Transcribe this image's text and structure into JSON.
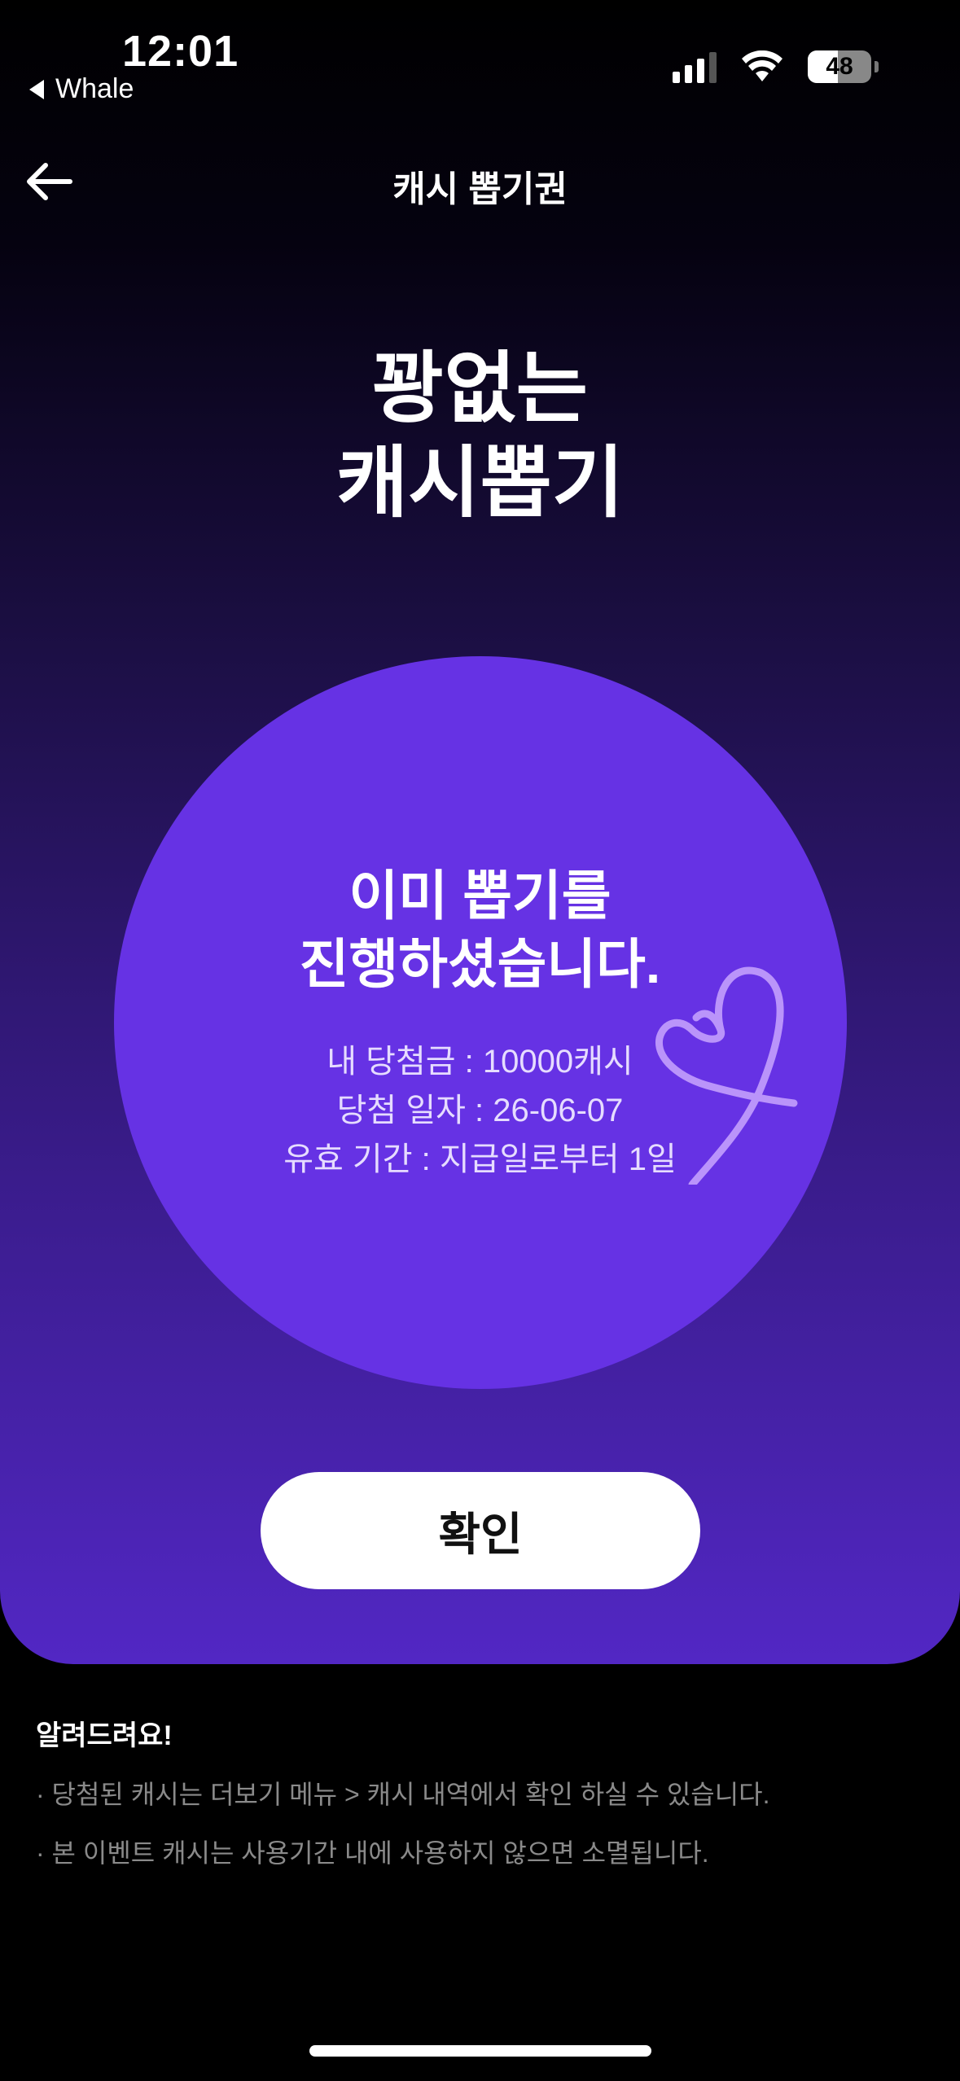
{
  "status_bar": {
    "time": "12:01",
    "back_app": "Whale",
    "battery_level": "48",
    "battery_fraction": 0.48
  },
  "nav": {
    "title": "캐시 뽑기권",
    "back_icon": "arrow-left-icon"
  },
  "hero": {
    "title_line1": "꽝없는",
    "title_line2": "캐시뽑기"
  },
  "result": {
    "title_line1": "이미 뽑기를",
    "title_line2": "진행하셨습니다.",
    "prize": "내 당첨금 : 10000캐시",
    "date": "당첨 일자 : 26-06-07",
    "validity": "유효 기간 : 지급일로부터 1일",
    "decoration_icon": "heart-doodle-icon"
  },
  "confirm_button": {
    "label": "확인"
  },
  "notice": {
    "title": "알려드려요!",
    "items": [
      "· 당첨된 캐시는 더보기 메뉴 > 캐시 내역에서 확인 하실 수 있습니다.",
      "· 본 이벤트 캐시는 사용기간 내에 사용하지 않으면 소멸됩니다."
    ]
  },
  "colors": {
    "accent": "#6632e4",
    "background": "#000000",
    "notice_text": "#8a8a8a"
  }
}
